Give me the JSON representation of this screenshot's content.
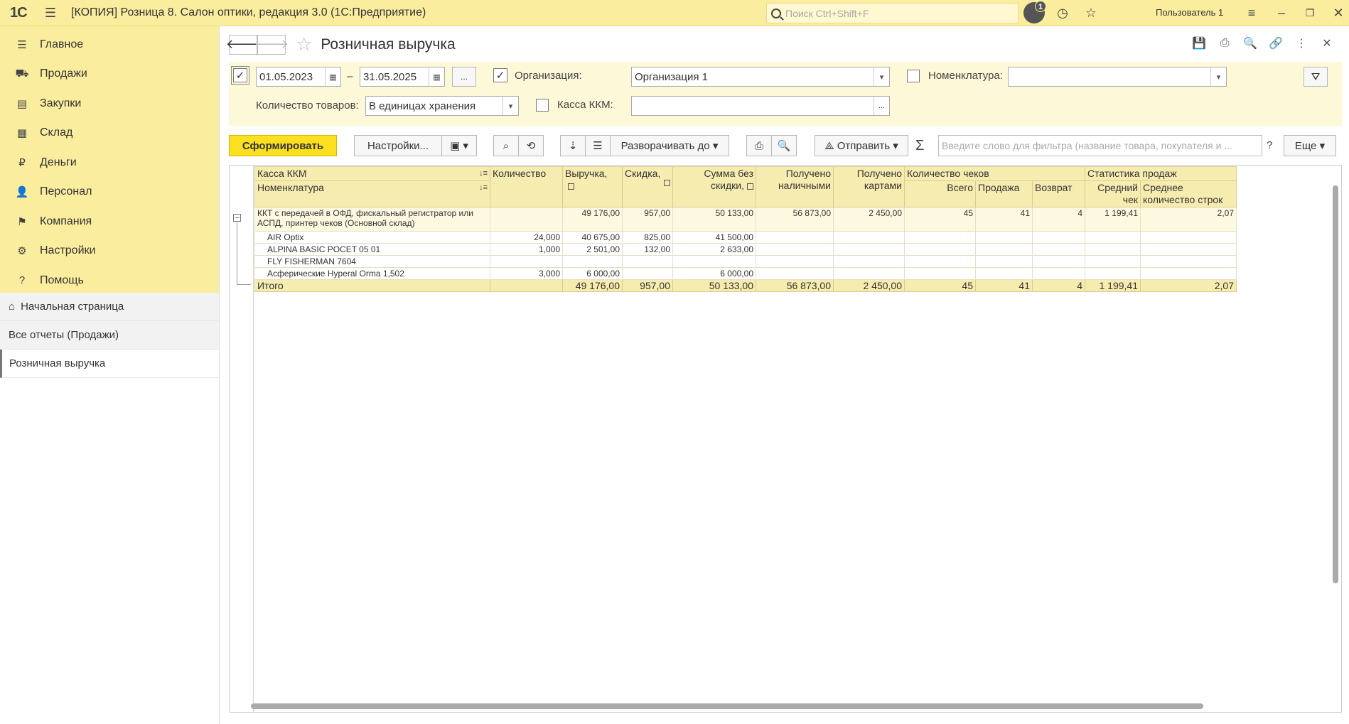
{
  "titlebar": {
    "logo": "1С",
    "title": "[КОПИЯ] Розница 8. Салон оптики, редакция 3.0  (1С:Предприятие)",
    "search_placeholder": "Поиск Ctrl+Shift+F",
    "notifications_count": "1",
    "user": "Пользователь 1"
  },
  "sidebar": {
    "sections": [
      {
        "label": "Главное",
        "icon": "menu-icon"
      },
      {
        "label": "Продажи",
        "icon": "cart-icon"
      },
      {
        "label": "Закупки",
        "icon": "purchases-icon"
      },
      {
        "label": "Склад",
        "icon": "warehouse-icon"
      },
      {
        "label": "Деньги",
        "icon": "ruble-icon"
      },
      {
        "label": "Персонал",
        "icon": "people-icon"
      },
      {
        "label": "Компания",
        "icon": "flag-icon"
      },
      {
        "label": "Настройки",
        "icon": "gear-icon"
      },
      {
        "label": "Помощь",
        "icon": "help-icon"
      }
    ],
    "open_windows": [
      "Начальная страница",
      "Все отчеты (Продажи)",
      "Розничная выручка"
    ]
  },
  "form": {
    "title": "Розничная выручка",
    "period_from": "01.05.2023",
    "dash": "–",
    "period_to": "31.05.2025",
    "ellipsis": "...",
    "org_label": "Организация:",
    "org_value": "Организация 1",
    "nom_label": "Номенклатура:",
    "nom_value": "",
    "qty_label": "Количество товаров:",
    "qty_value": "В единицах хранения",
    "kkm_label": "Касса ККМ:",
    "kkm_value": ""
  },
  "toolbar": {
    "generate": "Сформировать",
    "settings": "Настройки...",
    "expand_to": "Разворачивать до",
    "send": "Отправить",
    "sigma": "Σ",
    "filter_placeholder": "Введите слово для фильтра (название товара, покупателя и ...",
    "question": "?",
    "more": "Еще"
  },
  "report": {
    "headers": {
      "kkm": "Касса ККМ",
      "nomenclature": "Номенклатура",
      "quantity": "Количество",
      "revenue": "Выручка,",
      "discount": "Скидка,",
      "sum_no_discount": "Сумма без скидки,",
      "cash": "Получено наличными",
      "cards": "Получено картами",
      "checks_count": "Количество чеков",
      "total": "Всего",
      "sale": "Продажа",
      "return": "Возврат",
      "sales_stats": "Статистика продаж",
      "avg_check": "Средний чек",
      "avg_lines": "Среднее количество строк"
    },
    "group": {
      "name": "ККТ с передачей в ОФД, фискальный регистратор или АСПД, принтер чеков (Основной склад)",
      "quantity": "",
      "revenue": "49 176,00",
      "discount": "957,00",
      "sum_no_discount": "50 133,00",
      "cash": "56 873,00",
      "cards": "2 450,00",
      "total": "45",
      "sale": "41",
      "return": "4",
      "avg_check": "1 199,41",
      "avg_lines": "2,07"
    },
    "rows": [
      {
        "name": "AIR Optix",
        "quantity": "24,000",
        "revenue": "40 675,00",
        "discount": "825,00",
        "sum_no_discount": "41 500,00"
      },
      {
        "name": "ALPINA BASIC POCET 05 01",
        "quantity": "1,000",
        "revenue": "2 501,00",
        "discount": "132,00",
        "sum_no_discount": "2 633,00"
      },
      {
        "name": "FLY FISHERMAN 7604",
        "quantity": "",
        "revenue": "",
        "discount": "",
        "sum_no_discount": ""
      },
      {
        "name": "Асферические Hyperal Orma 1,502",
        "quantity": "3,000",
        "revenue": "6 000,00",
        "discount": "",
        "sum_no_discount": "6 000,00"
      }
    ],
    "totals": {
      "label": "Итого",
      "revenue": "49 176,00",
      "discount": "957,00",
      "sum_no_discount": "50 133,00",
      "cash": "56 873,00",
      "cards": "2 450,00",
      "total": "45",
      "sale": "41",
      "return": "4",
      "avg_check": "1 199,41",
      "avg_lines": "2,07"
    }
  }
}
